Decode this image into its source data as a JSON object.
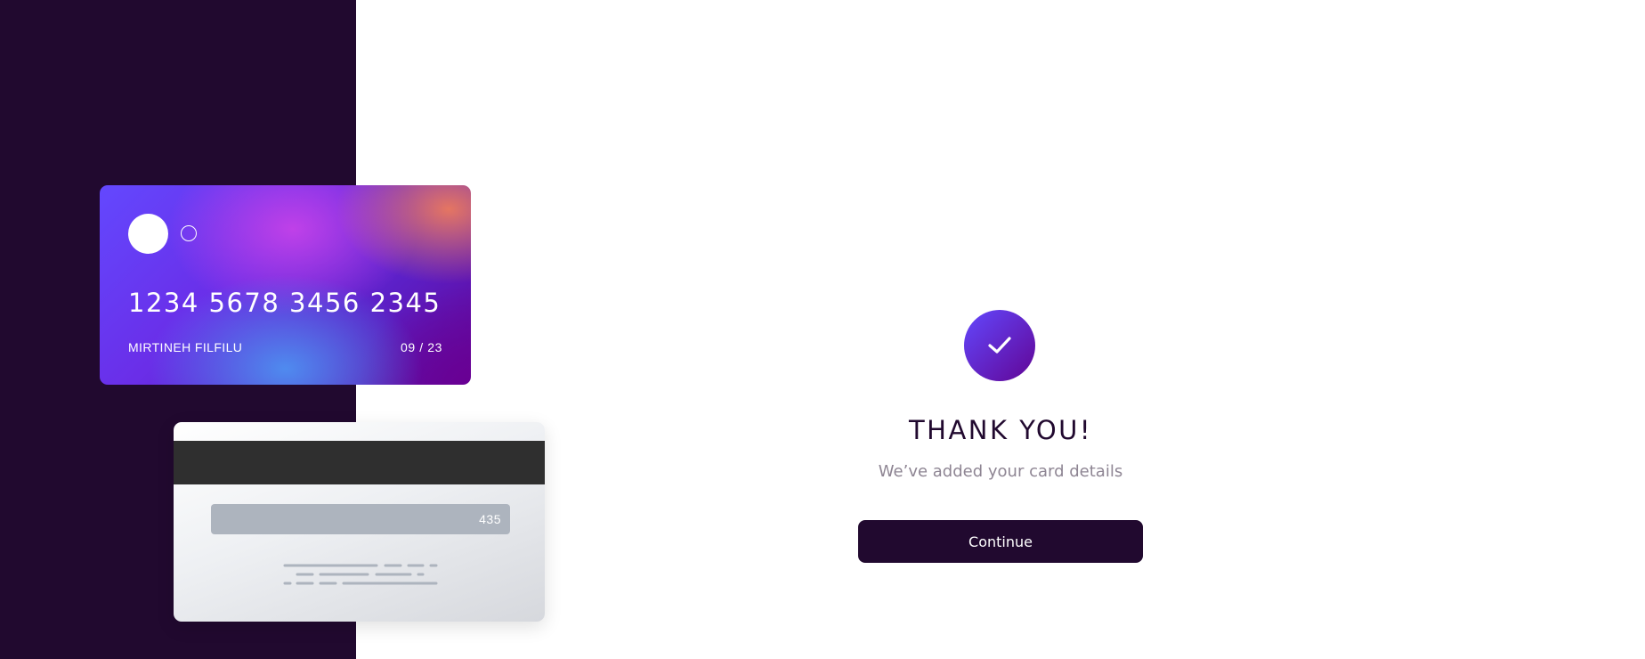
{
  "colors": {
    "left_panel_bg": "#21092f",
    "accent_start": "#6348fe",
    "accent_end": "#610595",
    "button_bg": "#21092f",
    "subtext": "#8e8593"
  },
  "card_front": {
    "number": "1234 5678 3456 2345",
    "holder": "MIRTINEH FILFILU",
    "expiry": "09 / 23"
  },
  "card_back": {
    "cvc": "435"
  },
  "confirmation": {
    "icon": "check-icon",
    "title": "THANK YOU!",
    "subtitle": "We’ve added your card details",
    "button_label": "Continue"
  }
}
